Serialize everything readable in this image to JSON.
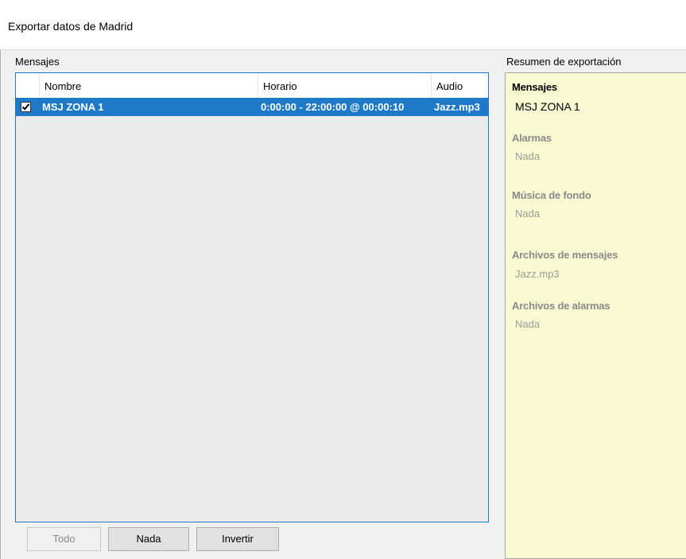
{
  "window": {
    "title": "Exportar datos de Madrid"
  },
  "messages_section": {
    "label": "Mensajes"
  },
  "table": {
    "columns": [
      "Nombre",
      "Horario",
      "Audio"
    ],
    "rows": [
      {
        "checked": true,
        "nombre": "MSJ ZONA 1",
        "horario": "0:00:00 - 22:00:00 @ 00:00:10",
        "audio": "Jazz.mp3",
        "selected": true
      }
    ]
  },
  "buttons": {
    "todo": "Todo",
    "nada": "Nada",
    "invertir": "Invertir"
  },
  "summary": {
    "label": "Resumen de exportación",
    "sections": [
      {
        "title": "Mensajes",
        "value": "MSJ ZONA 1"
      },
      {
        "title": "Alarmas",
        "value": "Nada"
      },
      {
        "title": "Música de fondo",
        "value": "Nada"
      },
      {
        "title": "Archivos de mensajes",
        "value": "Jazz.mp3"
      },
      {
        "title": "Archivos de alarmas",
        "value": "Nada"
      }
    ]
  },
  "colors": {
    "selection": "#1e79c9",
    "summary_bg": "#fafad2",
    "panel_bg": "#f0f0f0"
  }
}
